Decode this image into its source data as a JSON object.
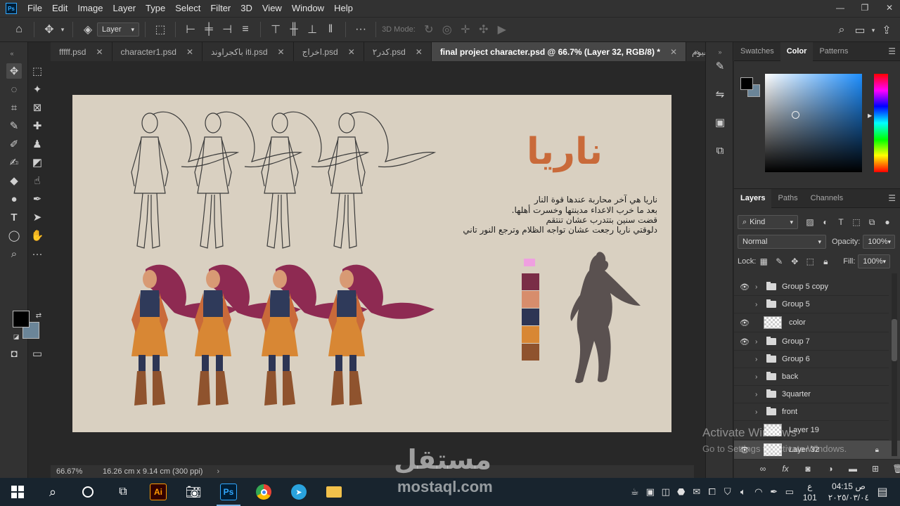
{
  "app": {
    "logo_text": "Ps"
  },
  "menu": [
    "File",
    "Edit",
    "Image",
    "Layer",
    "Type",
    "Select",
    "Filter",
    "3D",
    "View",
    "Window",
    "Help"
  ],
  "window_controls": {
    "minimize": "—",
    "restore": "❐",
    "close": "✕"
  },
  "options_bar": {
    "auto_select_target": "Layer",
    "mode_3d_label": "3D Mode:"
  },
  "tabs": [
    {
      "label": "fffff.psd",
      "close": "✕"
    },
    {
      "label": "character1.psd",
      "close": "✕"
    },
    {
      "label": "باكجراوند iti.psd",
      "close": "✕"
    },
    {
      "label": "اخراج.psd",
      "close": "✕"
    },
    {
      "label": "كدر٢.psd",
      "close": "✕"
    },
    {
      "label": "final project character.psd @ 66.7% (Layer 32, RGB/8) *",
      "close": "✕"
    },
    {
      "label": "وجوه الفيوم"
    }
  ],
  "document": {
    "title": "ناريا",
    "description": [
      "ناريا هي آخر محاربة عندها قوة النار",
      ".بعد ما خرب الاعداء مدينتها وخسرت أهلها",
      "قضت سنين بتتدرب عشان تنتقم",
      "دلوقتي ناريا رجعت عشان تواجه الظلام وترجع النور تاني"
    ],
    "palette": [
      "#ef9fe0",
      "#7a2d47",
      "#d78d6c",
      "#2d3554",
      "#d88734",
      "#8f532e"
    ]
  },
  "status": {
    "zoom": "66.67%",
    "doc_size": "16.26 cm x 9.14 cm (300 ppi)"
  },
  "color_panel": {
    "tabs": [
      "Swatches",
      "Color",
      "Patterns"
    ],
    "active_tab": "Color",
    "foreground": "#000000",
    "background": "#6b8598"
  },
  "layers_panel": {
    "tabs": [
      "Layers",
      "Paths",
      "Channels"
    ],
    "filter_kind": "Kind",
    "blend_mode": "Normal",
    "opacity_label": "Opacity:",
    "opacity": "100%",
    "lock_label": "Lock:",
    "fill_label": "Fill:",
    "fill": "100%",
    "layers": [
      {
        "name": "Group 5 copy",
        "visible": true,
        "type": "group"
      },
      {
        "name": "Group 5",
        "visible": false,
        "type": "group"
      },
      {
        "name": "color",
        "visible": true,
        "type": "layer"
      },
      {
        "name": "Group 7",
        "visible": true,
        "type": "group"
      },
      {
        "name": "Group 6",
        "visible": false,
        "type": "group"
      },
      {
        "name": "back",
        "visible": false,
        "type": "group"
      },
      {
        "name": "3quarter",
        "visible": false,
        "type": "group"
      },
      {
        "name": "front",
        "visible": false,
        "type": "group"
      },
      {
        "name": "Layer 19",
        "visible": false,
        "type": "layer"
      },
      {
        "name": "Layer 32",
        "visible": true,
        "type": "layer"
      }
    ]
  },
  "watermark": {
    "activate": "Activate Windows",
    "activate_sub": "Go to Settings to activate Windows.",
    "site_ar": "مستقل",
    "site_en": "mostaql.com"
  },
  "taskbar": {
    "time": "04:15",
    "ampm": "ص",
    "date": "٢٠٢٥/٠٣/٠٤",
    "lang": "ع",
    "lang_sub": "101"
  }
}
